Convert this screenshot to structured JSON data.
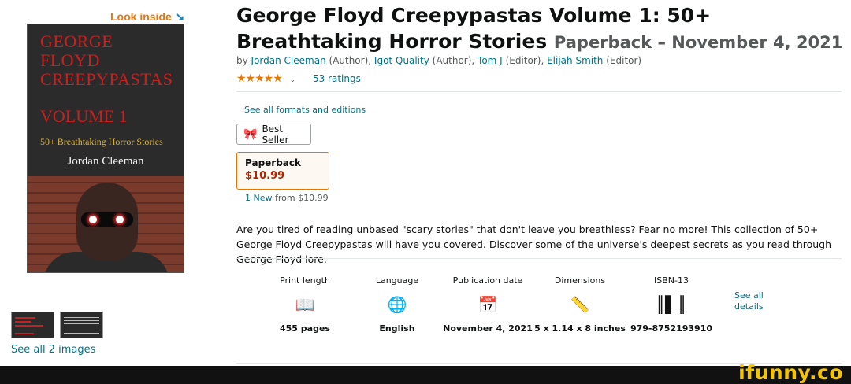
{
  "look_inside": {
    "label": "Look inside",
    "arrow": "↘"
  },
  "cover": {
    "title_line1": "GEORGE",
    "title_line2": "FLOYD",
    "title_line3": "CREEPYPASTAS",
    "volume": "VOLUME 1",
    "subtitle": "50+ Breathtaking Horror Stories",
    "author": "Jordan Cleeman"
  },
  "images": {
    "see_all": "See all 2 images"
  },
  "product": {
    "title": "George Floyd Creepypastas Volume 1: 50+ Breathtaking Horror Stories",
    "format_date": "Paperback – November 4, 2021",
    "by": "by",
    "contributors": [
      {
        "name": "Jordan Cleeman",
        "role": "(Author),"
      },
      {
        "name": "Igot Quality",
        "role": "(Author),"
      },
      {
        "name": "Tom J",
        "role": "(Editor),"
      },
      {
        "name": "Elijah Smith",
        "role": "(Editor)"
      }
    ],
    "stars": "★★★★★",
    "rating_value": 5,
    "ratings_count": "53 ratings"
  },
  "formats": {
    "see_all": "See all formats and editions",
    "badge": "Best Seller",
    "selected_format": "Paperback",
    "price": "$10.99",
    "new_from_count": "1 New",
    "new_from_text": "from $10.99"
  },
  "description": "Are you tired of reading unbased \"scary stories\" that don't leave you breathless? Fear no more! This collection of 50+ George Floyd Creepypastas will have you covered. Discover some of the universe's deepest secrets as you read through George Floyd lore.",
  "details": [
    {
      "label": "Print length",
      "icon": "book-pages-icon",
      "glyph": "📖",
      "value": "455 pages"
    },
    {
      "label": "Language",
      "icon": "globe-icon",
      "glyph": "🌐",
      "value": "English"
    },
    {
      "label": "Publication date",
      "icon": "calendar-icon",
      "glyph": "📅",
      "value": "November 4, 2021"
    },
    {
      "label": "Dimensions",
      "icon": "ruler-icon",
      "glyph": "📏",
      "value": "5 x 1.14 x 8 inches"
    },
    {
      "label": "ISBN-13",
      "icon": "barcode-icon",
      "glyph": "║▌║",
      "value": "979-8752193910"
    }
  ],
  "see_all_details": "See all details",
  "watermark": "ifunny.co",
  "colors": {
    "link": "#007185",
    "price": "#b12704",
    "star": "#e67a00",
    "selected_border": "#e77600",
    "cover_red": "#c7201f",
    "watermark": "#f5c400"
  }
}
